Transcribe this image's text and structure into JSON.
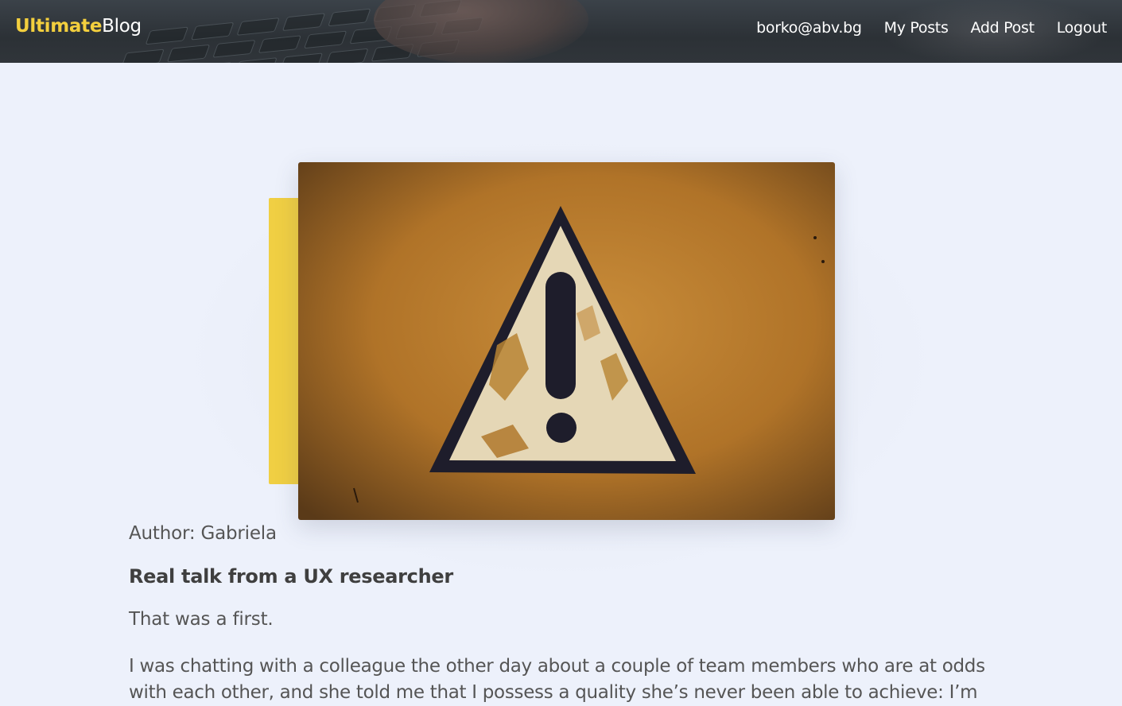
{
  "header": {
    "logo_primary": "Ultimate",
    "logo_secondary": "Blog",
    "nav": {
      "email": "borko@abv.bg",
      "my_posts": "My Posts",
      "add_post": "Add Post",
      "logout": "Logout"
    }
  },
  "post": {
    "image": {
      "icon": "warning-triangle-exclamation",
      "colors": {
        "background": "#b87a2a",
        "triangle_fill": "#e5d7b6",
        "triangle_stroke": "#1e1d2b",
        "accent": "#f0cf43"
      }
    },
    "author": "Author: Gabriela",
    "title": "Real talk from a UX researcher",
    "lead": "That was a first.",
    "body": "I was chatting with a colleague the other day about a couple of team members who are at odds with each other, and she told me that I possess a quality she’s never been able to achieve: I’m"
  },
  "theme": {
    "brand_yellow": "#f3cf3e",
    "page_background": "#edf1fb",
    "header_background": "#30353a"
  }
}
